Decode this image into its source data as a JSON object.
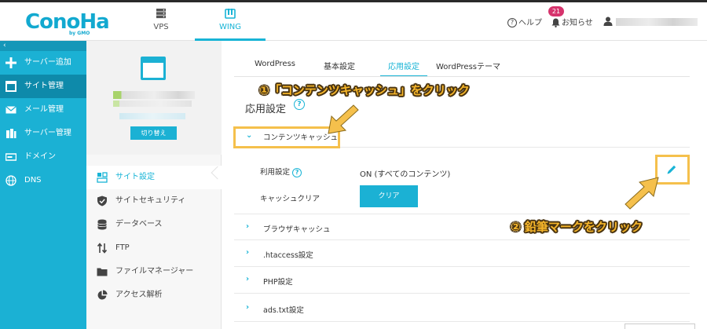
{
  "header": {
    "logo_text": "ConoHa",
    "logo_sub": "by GMO",
    "tabs": [
      {
        "label": "VPS",
        "active": false
      },
      {
        "label": "WING",
        "active": true
      }
    ],
    "help_label": "ヘルプ",
    "notify_label": "お知らせ",
    "notify_count": "21"
  },
  "sidebar": {
    "collapse_glyph": "‹",
    "items": [
      {
        "label": "サーバー追加",
        "icon": "plus-icon",
        "active": false
      },
      {
        "label": "サイト管理",
        "icon": "window-icon",
        "active": true
      },
      {
        "label": "メール管理",
        "icon": "mail-icon",
        "active": false
      },
      {
        "label": "サーバー管理",
        "icon": "server-icon",
        "active": false
      },
      {
        "label": "ドメイン",
        "icon": "domain-icon",
        "active": false
      },
      {
        "label": "DNS",
        "icon": "globe-icon",
        "active": false
      }
    ]
  },
  "site_panel": {
    "switch_label": "切り替え",
    "menu": [
      {
        "label": "サイト設定",
        "icon": "layout-icon",
        "active": true
      },
      {
        "label": "サイトセキュリティ",
        "icon": "shield-icon",
        "active": false
      },
      {
        "label": "データベース",
        "icon": "database-icon",
        "active": false
      },
      {
        "label": "FTP",
        "icon": "transfer-icon",
        "active": false
      },
      {
        "label": "ファイルマネージャー",
        "icon": "folder-icon",
        "active": false
      },
      {
        "label": "アクセス解析",
        "icon": "pie-chart-icon",
        "active": false
      }
    ]
  },
  "content": {
    "tabs": [
      {
        "label": "WordPress",
        "active": false
      },
      {
        "label": "基本設定",
        "active": false
      },
      {
        "label": "応用設定",
        "active": true
      },
      {
        "label": "WordPressテーマ",
        "active": false
      }
    ],
    "section_title": "応用設定",
    "help_glyph": "?",
    "cache": {
      "label": "コンテンツキャッシュ",
      "usage_label": "利用設定",
      "usage_value": "ON (すべてのコンテンツ)",
      "clear_label": "キャッシュクリア",
      "clear_button": "クリア"
    },
    "accordions": [
      {
        "label": "ブラウザキャッシュ"
      },
      {
        "label": ".htaccess設定"
      },
      {
        "label": "PHP設定"
      },
      {
        "label": "ads.txt設定"
      }
    ]
  },
  "annotations": {
    "step1": "①「コンテンツキャッシュ」をクリック",
    "step2": "② 鉛筆マークをクリック"
  },
  "colors": {
    "accent": "#1bb1d4",
    "sidebar_active": "#0e8aaa",
    "highlight": "#f5c04c",
    "badge": "#d6336c"
  }
}
